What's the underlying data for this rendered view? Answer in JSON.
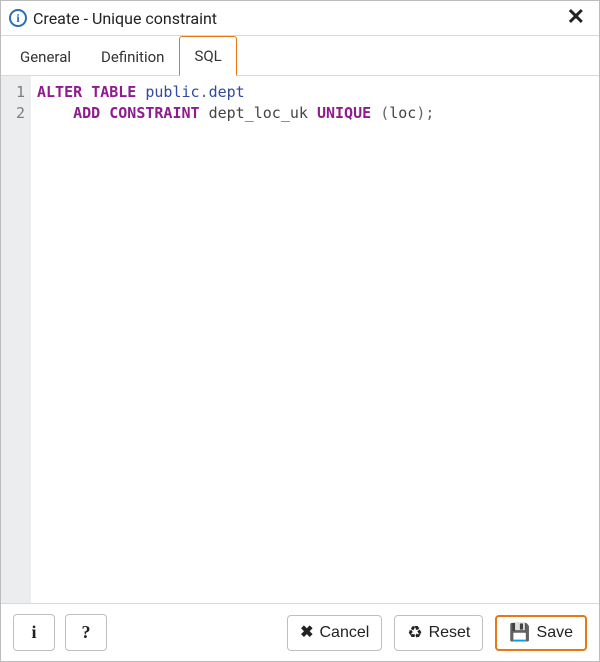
{
  "dialog": {
    "title": "Create - Unique constraint",
    "info_icon_label": "i",
    "close_label": "✕"
  },
  "tabs": {
    "items": [
      {
        "label": "General",
        "active": false
      },
      {
        "label": "Definition",
        "active": false
      },
      {
        "label": "SQL",
        "active": true
      }
    ]
  },
  "sql": {
    "line_numbers": [
      "1",
      "2"
    ],
    "line1": {
      "kw1": "ALTER",
      "kw2": "TABLE",
      "schema": "public",
      "dot": ".",
      "table": "dept"
    },
    "line2": {
      "indent": "    ",
      "kw1": "ADD",
      "kw2": "CONSTRAINT",
      "name": "dept_loc_uk",
      "kw3": "UNIQUE",
      "lp": "(",
      "col": "loc",
      "rp": ");"
    }
  },
  "footer": {
    "info_label": "i",
    "help_label": "?",
    "cancel_label": "Cancel",
    "reset_label": "Reset",
    "save_label": "Save",
    "cancel_glyph": "✖",
    "reset_glyph": "♻",
    "save_glyph": "💾"
  }
}
